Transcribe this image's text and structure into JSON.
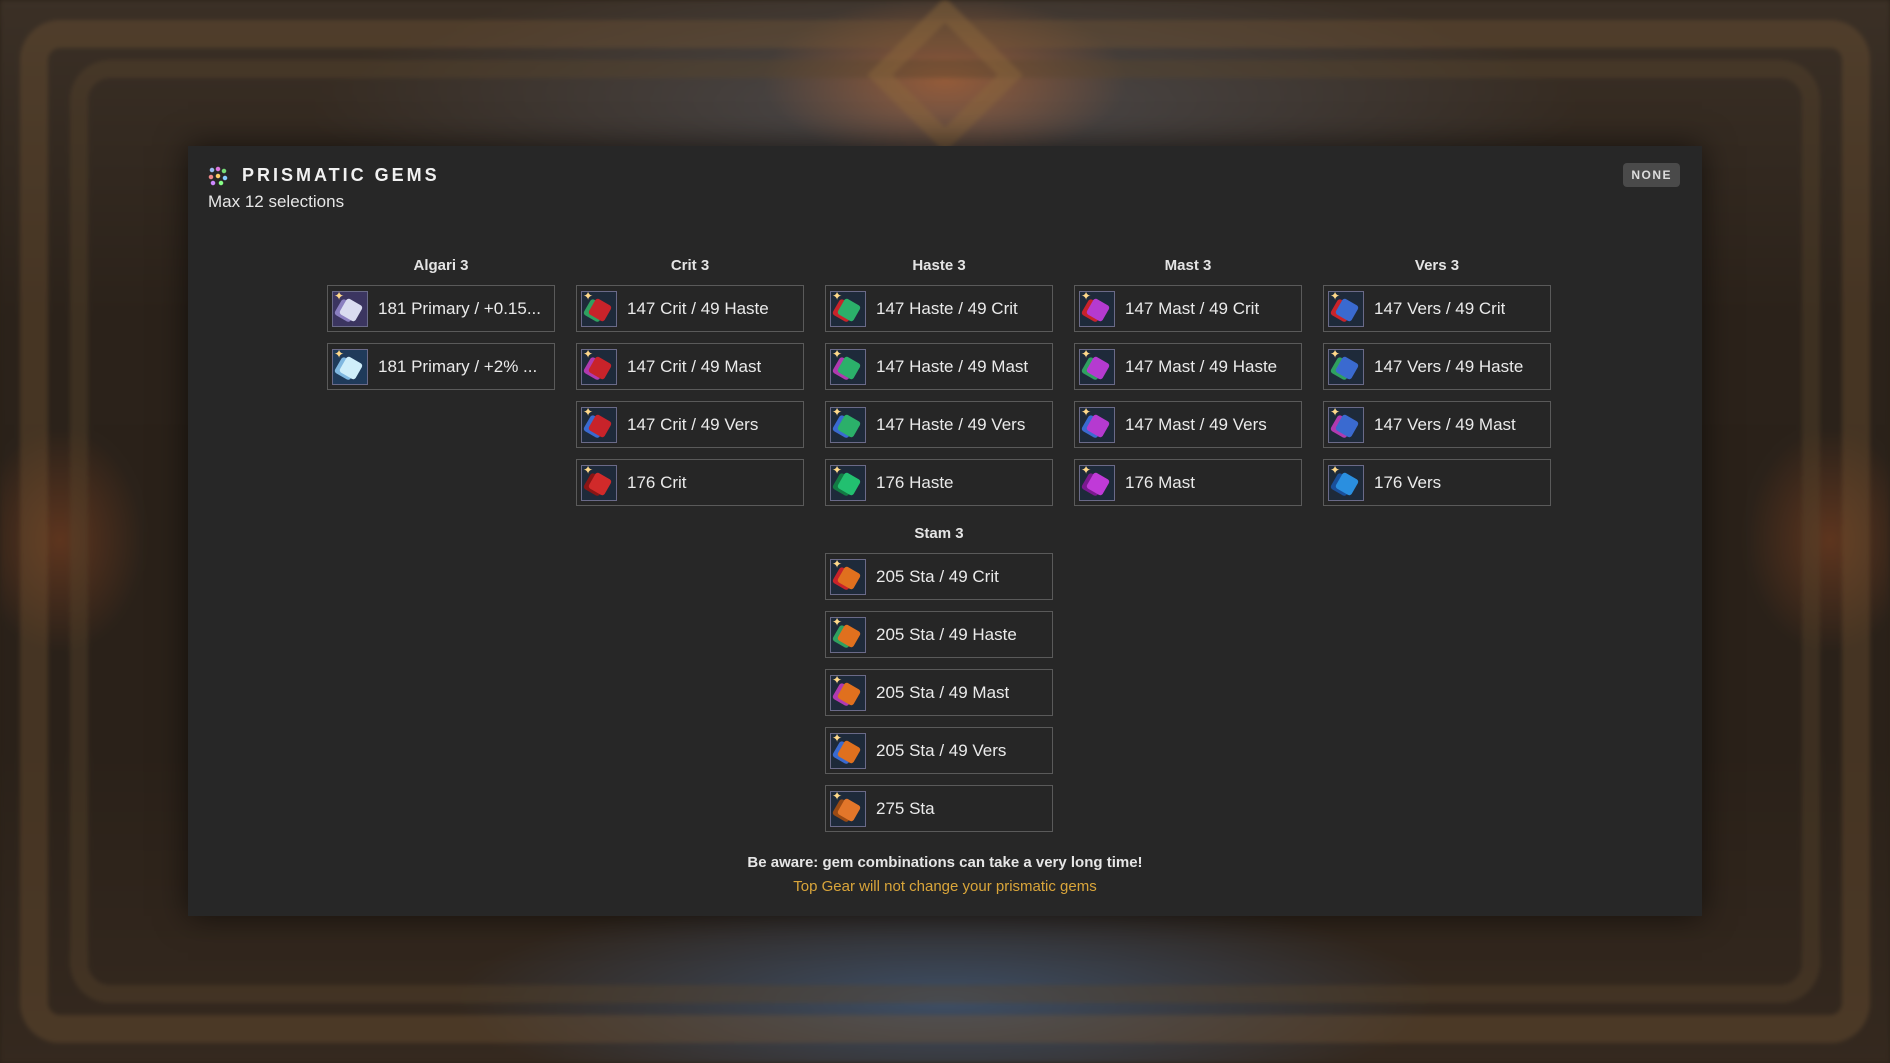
{
  "header": {
    "title": "PRISMATIC GEMS",
    "subtitle": "Max 12 selections",
    "none_button": "NONE"
  },
  "groups": {
    "algari": {
      "label": "Algari 3",
      "items": [
        "181 Primary / +0.15...",
        "181 Primary / +2% ..."
      ]
    },
    "crit": {
      "label": "Crit 3",
      "items": [
        "147 Crit / 49 Haste",
        "147 Crit / 49 Mast",
        "147 Crit / 49 Vers",
        "176 Crit"
      ]
    },
    "haste": {
      "label": "Haste 3",
      "items": [
        "147 Haste / 49 Crit",
        "147 Haste / 49 Mast",
        "147 Haste / 49 Vers",
        "176 Haste"
      ]
    },
    "mast": {
      "label": "Mast 3",
      "items": [
        "147 Mast / 49 Crit",
        "147 Mast / 49 Haste",
        "147 Mast / 49 Vers",
        "176 Mast"
      ]
    },
    "vers": {
      "label": "Vers 3",
      "items": [
        "147 Vers / 49 Crit",
        "147 Vers / 49 Haste",
        "147 Vers / 49 Mast",
        "176 Vers"
      ]
    },
    "stam": {
      "label": "Stam 3",
      "items": [
        "205 Sta / 49 Crit",
        "205 Sta / 49 Haste",
        "205 Sta / 49 Mast",
        "205 Sta / 49 Vers",
        "275 Sta"
      ]
    }
  },
  "footer": {
    "warning": "Be aware: gem combinations can take a very long time!",
    "note": "Top Gear will not change your prismatic gems"
  },
  "colors": {
    "accent_note": "#d9a53a",
    "panel_bg": "#272727"
  }
}
